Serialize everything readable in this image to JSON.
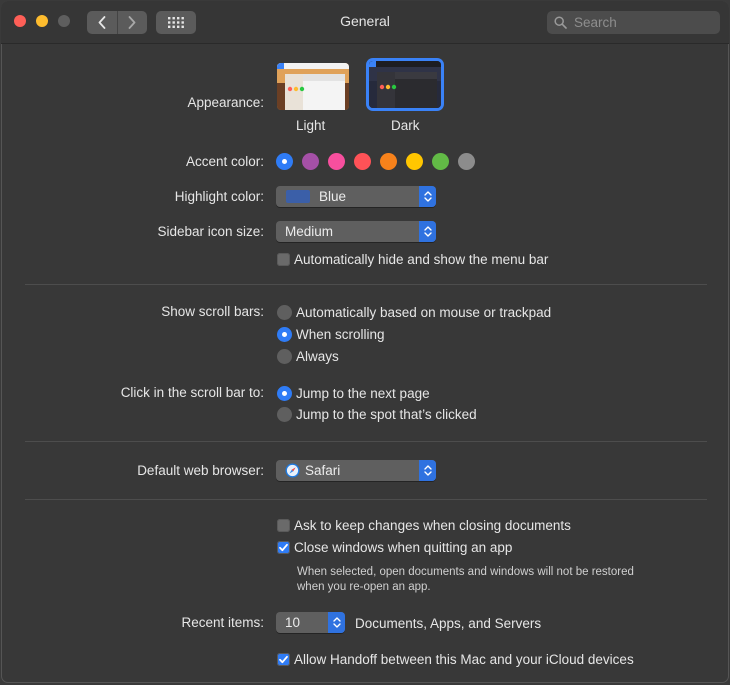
{
  "window": {
    "title": "General",
    "search": {
      "placeholder": "Search"
    }
  },
  "appearance": {
    "label": "Appearance:",
    "options": [
      "Light",
      "Dark"
    ],
    "selected": "Dark"
  },
  "accent": {
    "label": "Accent color:",
    "colors": [
      "#2f7cf6",
      "#a550a7",
      "#f74f9e",
      "#ff5257",
      "#f7821b",
      "#ffc600",
      "#62ba46",
      "#8c8c8c"
    ],
    "selected_index": 0
  },
  "highlight": {
    "label": "Highlight color:",
    "value": "Blue",
    "swatch": "#3b5fa8"
  },
  "sidebar_icon_size": {
    "label": "Sidebar icon size:",
    "value": "Medium"
  },
  "menu_bar": {
    "label": "Automatically hide and show the menu bar",
    "checked": false
  },
  "scroll_bars": {
    "label": "Show scroll bars:",
    "options": [
      "Automatically based on mouse or trackpad",
      "When scrolling",
      "Always"
    ],
    "selected_index": 1
  },
  "click_scroll": {
    "label": "Click in the scroll bar to:",
    "options": [
      "Jump to the next page",
      "Jump to the spot that’s clicked"
    ],
    "selected_index": 0
  },
  "browser": {
    "label": "Default web browser:",
    "value": "Safari"
  },
  "documents": {
    "ask_keep": {
      "label": "Ask to keep changes when closing documents",
      "checked": false
    },
    "close_windows": {
      "label": "Close windows when quitting an app",
      "checked": true
    },
    "note_line1": "When selected, open documents and windows will not be restored",
    "note_line2": "when you re-open an app."
  },
  "recent": {
    "label": "Recent items:",
    "value": "10",
    "suffix": "Documents, Apps, and Servers"
  },
  "handoff": {
    "label": "Allow Handoff between this Mac and your iCloud devices",
    "checked": true
  },
  "colors": {
    "accent": "#2f7cf6",
    "window_bg": "#383838",
    "popup_bg": "#5f5f5f"
  }
}
